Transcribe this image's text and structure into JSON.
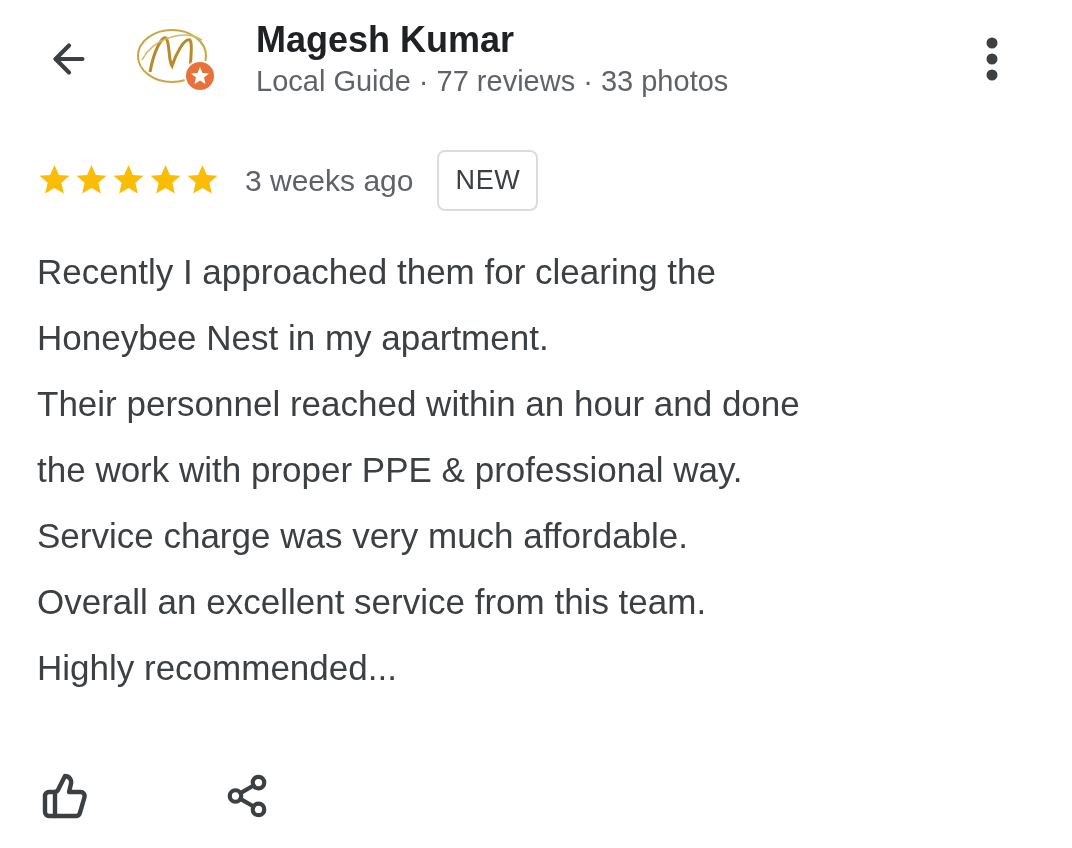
{
  "reviewer": {
    "name": "Magesh Kumar",
    "local_guide": true,
    "details": "Local Guide · 77 reviews · 33 photos"
  },
  "review": {
    "stars": 5,
    "time": "3 weeks ago",
    "badge": "NEW",
    "lines": [
      "Recently I approached them for clearing the",
      "Honeybee Nest in my apartment.",
      "Their personnel reached within an hour and done",
      "the work with proper PPE & professional way.",
      "Service charge was very much affordable.",
      "Overall an excellent service from this team.",
      "Highly recommended..."
    ]
  }
}
